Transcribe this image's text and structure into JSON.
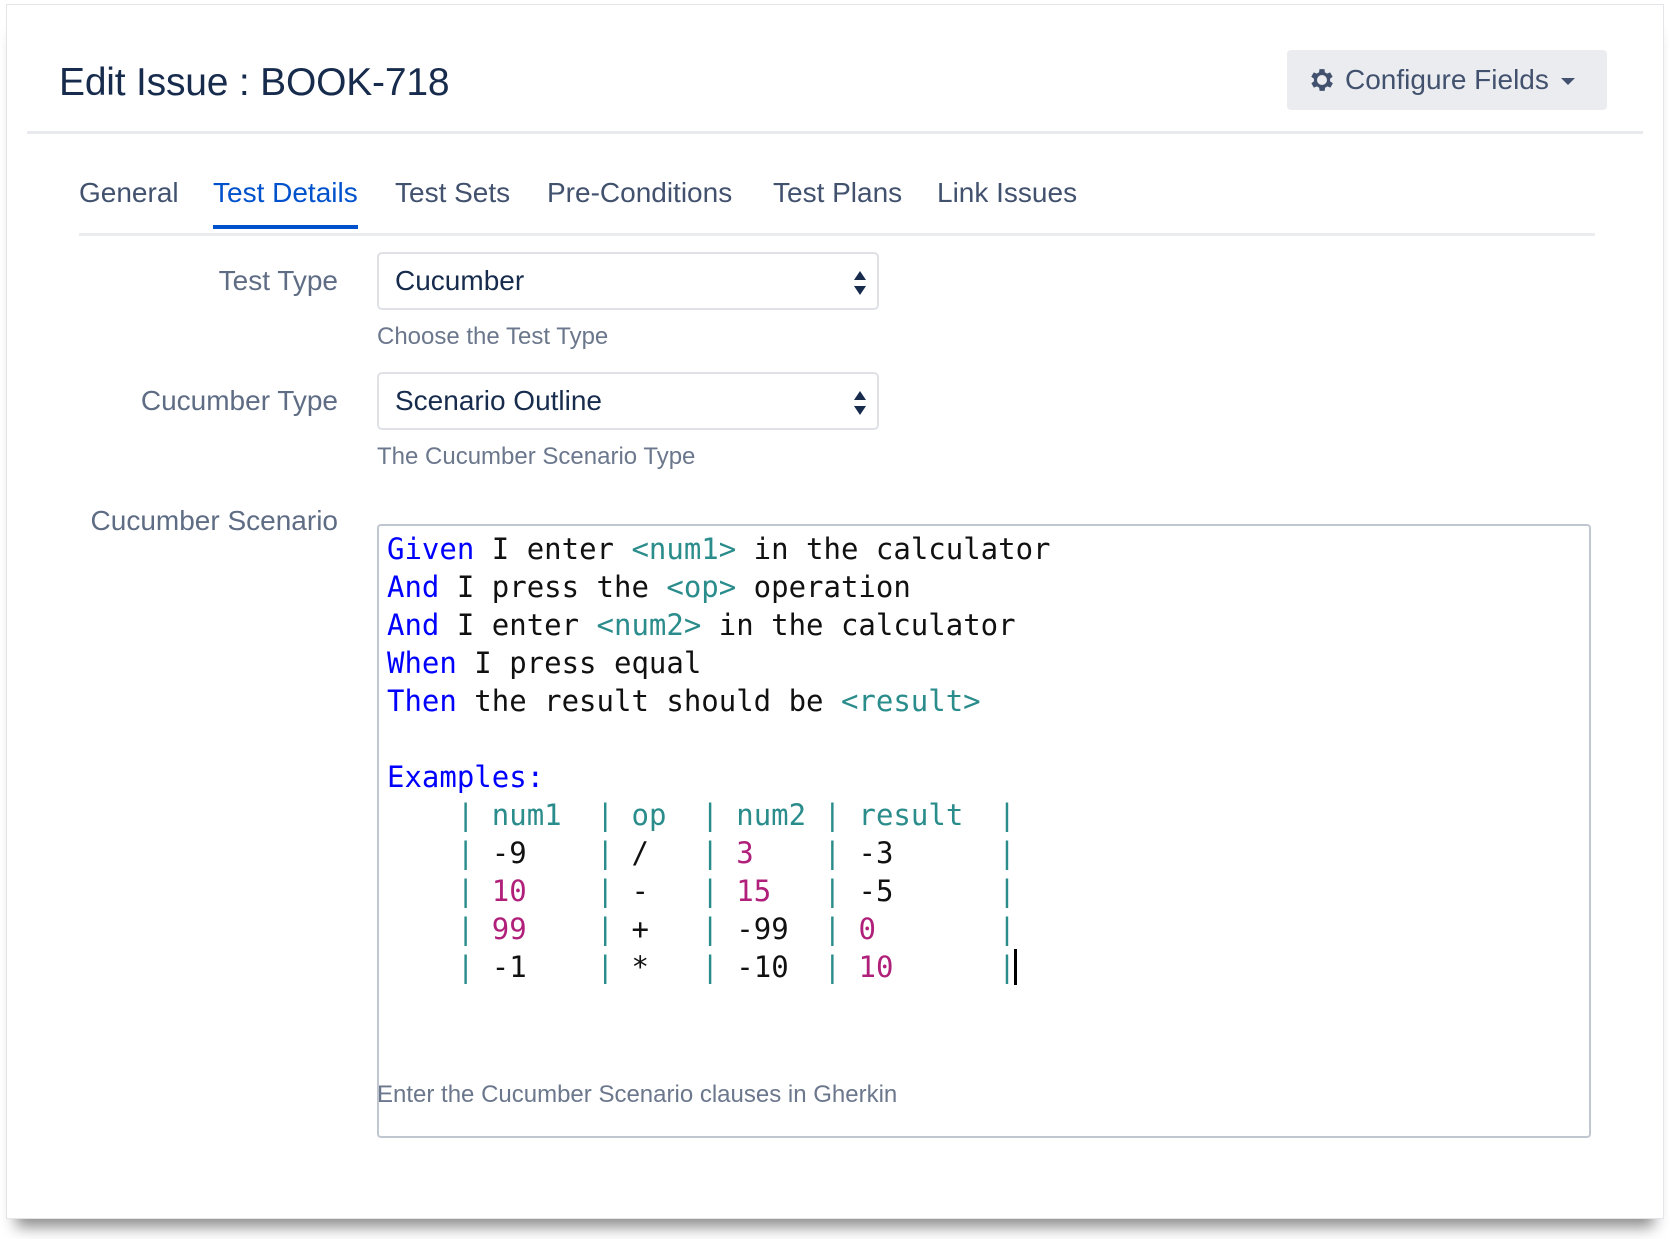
{
  "header": {
    "title": "Edit Issue : BOOK-718",
    "configure_label": "Configure Fields"
  },
  "tabs": [
    {
      "label": "General",
      "active": false
    },
    {
      "label": "Test Details",
      "active": true
    },
    {
      "label": "Test Sets",
      "active": false
    },
    {
      "label": "Pre-Conditions",
      "active": false
    },
    {
      "label": "Test Plans",
      "active": false
    },
    {
      "label": "Link Issues",
      "active": false
    }
  ],
  "fields": {
    "test_type": {
      "label": "Test Type",
      "value": "Cucumber",
      "help": "Choose the Test Type"
    },
    "cucumber_type": {
      "label": "Cucumber Type",
      "value": "Scenario Outline",
      "help": "The Cucumber Scenario Type"
    },
    "scenario": {
      "label": "Cucumber Scenario",
      "help": "Enter the Cucumber Scenario clauses in Gherkin",
      "steps": [
        {
          "keyword": "Given",
          "parts": [
            " I enter ",
            "<num1>",
            " in the calculator"
          ]
        },
        {
          "keyword": "And",
          "parts": [
            " I press the ",
            "<op>",
            " operation"
          ]
        },
        {
          "keyword": "And",
          "parts": [
            " I enter ",
            "<num2>",
            " in the calculator"
          ]
        },
        {
          "keyword": "When",
          "parts": [
            " I press equal"
          ]
        },
        {
          "keyword": "Then",
          "parts": [
            " the result should be ",
            "<result>"
          ]
        }
      ],
      "examples_keyword": "Examples:",
      "table": {
        "headers": [
          "num1",
          "op",
          "num2",
          "result"
        ],
        "rows": [
          [
            "-9",
            "/",
            "3",
            "-3"
          ],
          [
            "10",
            "-",
            "15",
            "-5"
          ],
          [
            "99",
            "+",
            "-99",
            "0"
          ],
          [
            "-1",
            "*",
            "-10",
            "10"
          ]
        ]
      }
    }
  },
  "colors": {
    "accent": "#0052cc",
    "keyword": "#0000ff",
    "placeholder": "#2b8c8c",
    "number": "#b0207a"
  }
}
